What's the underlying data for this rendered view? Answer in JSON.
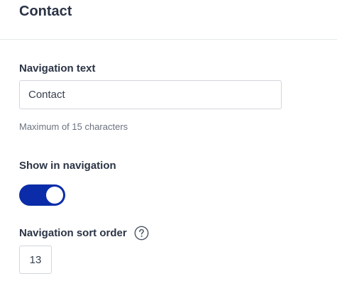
{
  "header": {
    "title": "Contact"
  },
  "navigation_text": {
    "label": "Navigation text",
    "value": "Contact",
    "helper": "Maximum of 15 characters"
  },
  "show_in_navigation": {
    "label": "Show in navigation",
    "checked": true
  },
  "sort_order": {
    "label": "Navigation sort order",
    "help_icon": "question-circle-icon",
    "value": "13"
  },
  "colors": {
    "toggle_on": "#0a2ca8",
    "title": "#2b3445",
    "helper": "#6b7280"
  }
}
